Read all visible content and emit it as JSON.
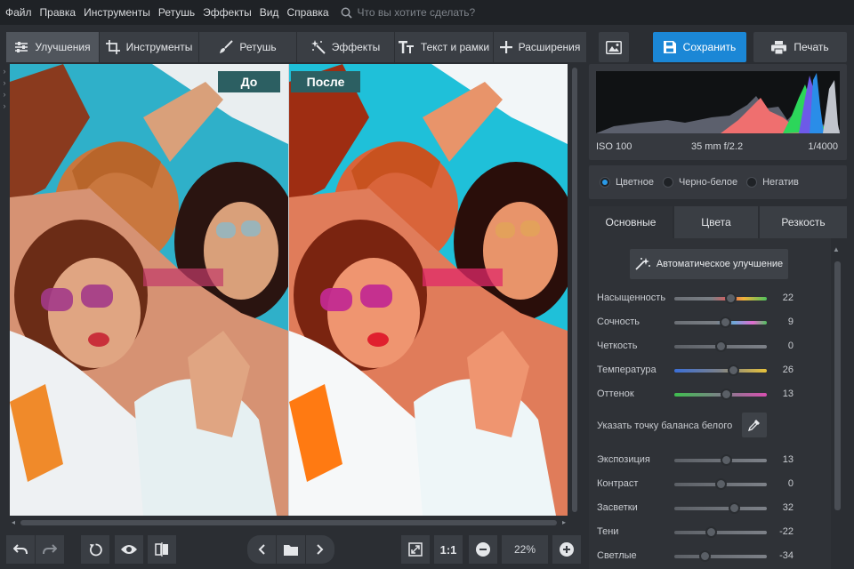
{
  "menu": {
    "items": [
      "Файл",
      "Правка",
      "Инструменты",
      "Ретушь",
      "Эффекты",
      "Вид",
      "Справка"
    ],
    "search_placeholder": "Что вы хотите сделать?"
  },
  "toolbar": {
    "tabs": [
      {
        "label": "Улучшения",
        "icon": "sliders-icon",
        "active": true
      },
      {
        "label": "Инструменты",
        "icon": "crop-icon",
        "active": false
      },
      {
        "label": "Ретушь",
        "icon": "brush-icon",
        "active": false
      },
      {
        "label": "Эффекты",
        "icon": "sparkle-wand-icon",
        "active": false
      },
      {
        "label": "Текст и рамки",
        "icon": "text-icon",
        "active": false
      },
      {
        "label": "Расширения",
        "icon": "plus-icon",
        "active": false
      }
    ],
    "image_icon": "image-icon",
    "save_label": "Сохранить",
    "print_label": "Печать",
    "accent": "#1b87d6"
  },
  "compare": {
    "before_label": "До",
    "after_label": "После",
    "tag_color": "#2c5f62"
  },
  "bottom": {
    "zoom_ratio_label": "1:1",
    "zoom_value": "22%"
  },
  "histogram": {
    "iso": "ISO 100",
    "lens": "35 mm f/2.2",
    "shutter": "1/4000"
  },
  "modes": [
    "Цветное",
    "Черно-белое",
    "Негатив"
  ],
  "selected_mode": "Цветное",
  "panel_tabs": [
    "Основные",
    "Цвета",
    "Резкость"
  ],
  "auto_label": "Автоматическое улучшение",
  "white_balance_label": "Указать точку баланса белого",
  "sliders": [
    {
      "label": "Насыщенность",
      "value": "22",
      "fraction": 0.61,
      "gradient": "linear-gradient(90deg,#6b6f75,#7a7f85 40%,#e35b5b 60%,#f0b33a 75%,#4fc25c)"
    },
    {
      "label": "Сочность",
      "value": "9",
      "fraction": 0.55,
      "gradient": "linear-gradient(90deg,#6b6f75,#7a7f85 45%,#6fa7d8 65%,#e26bd0 85%,#4fc25c)"
    },
    {
      "label": "Четкость",
      "value": "0",
      "fraction": 0.5,
      "gradient": "linear-gradient(90deg,#5c6066,#7d8188)"
    },
    {
      "label": "Температура",
      "value": "26",
      "fraction": 0.63,
      "gradient": "linear-gradient(90deg,#3b6fd8,#7d8188 50%,#e8c23a)"
    },
    {
      "label": "Оттенок",
      "value": "13",
      "fraction": 0.56,
      "gradient": "linear-gradient(90deg,#3fbf4f,#7d8188 50%,#d84fb0)"
    },
    {
      "label": "Экспозиция",
      "value": "13",
      "fraction": 0.56,
      "gradient": "linear-gradient(90deg,#5c6066,#7d8188)"
    },
    {
      "label": "Контраст",
      "value": "0",
      "fraction": 0.5,
      "gradient": "linear-gradient(90deg,#5c6066,#7d8188)"
    },
    {
      "label": "Засветки",
      "value": "32",
      "fraction": 0.64,
      "gradient": "linear-gradient(90deg,#5c6066,#7d8188)"
    },
    {
      "label": "Тени",
      "value": "-22",
      "fraction": 0.39,
      "gradient": "linear-gradient(90deg,#5c6066,#7d8188)"
    },
    {
      "label": "Светлые",
      "value": "-34",
      "fraction": 0.33,
      "gradient": "linear-gradient(90deg,#5c6066,#7d8188)"
    }
  ]
}
